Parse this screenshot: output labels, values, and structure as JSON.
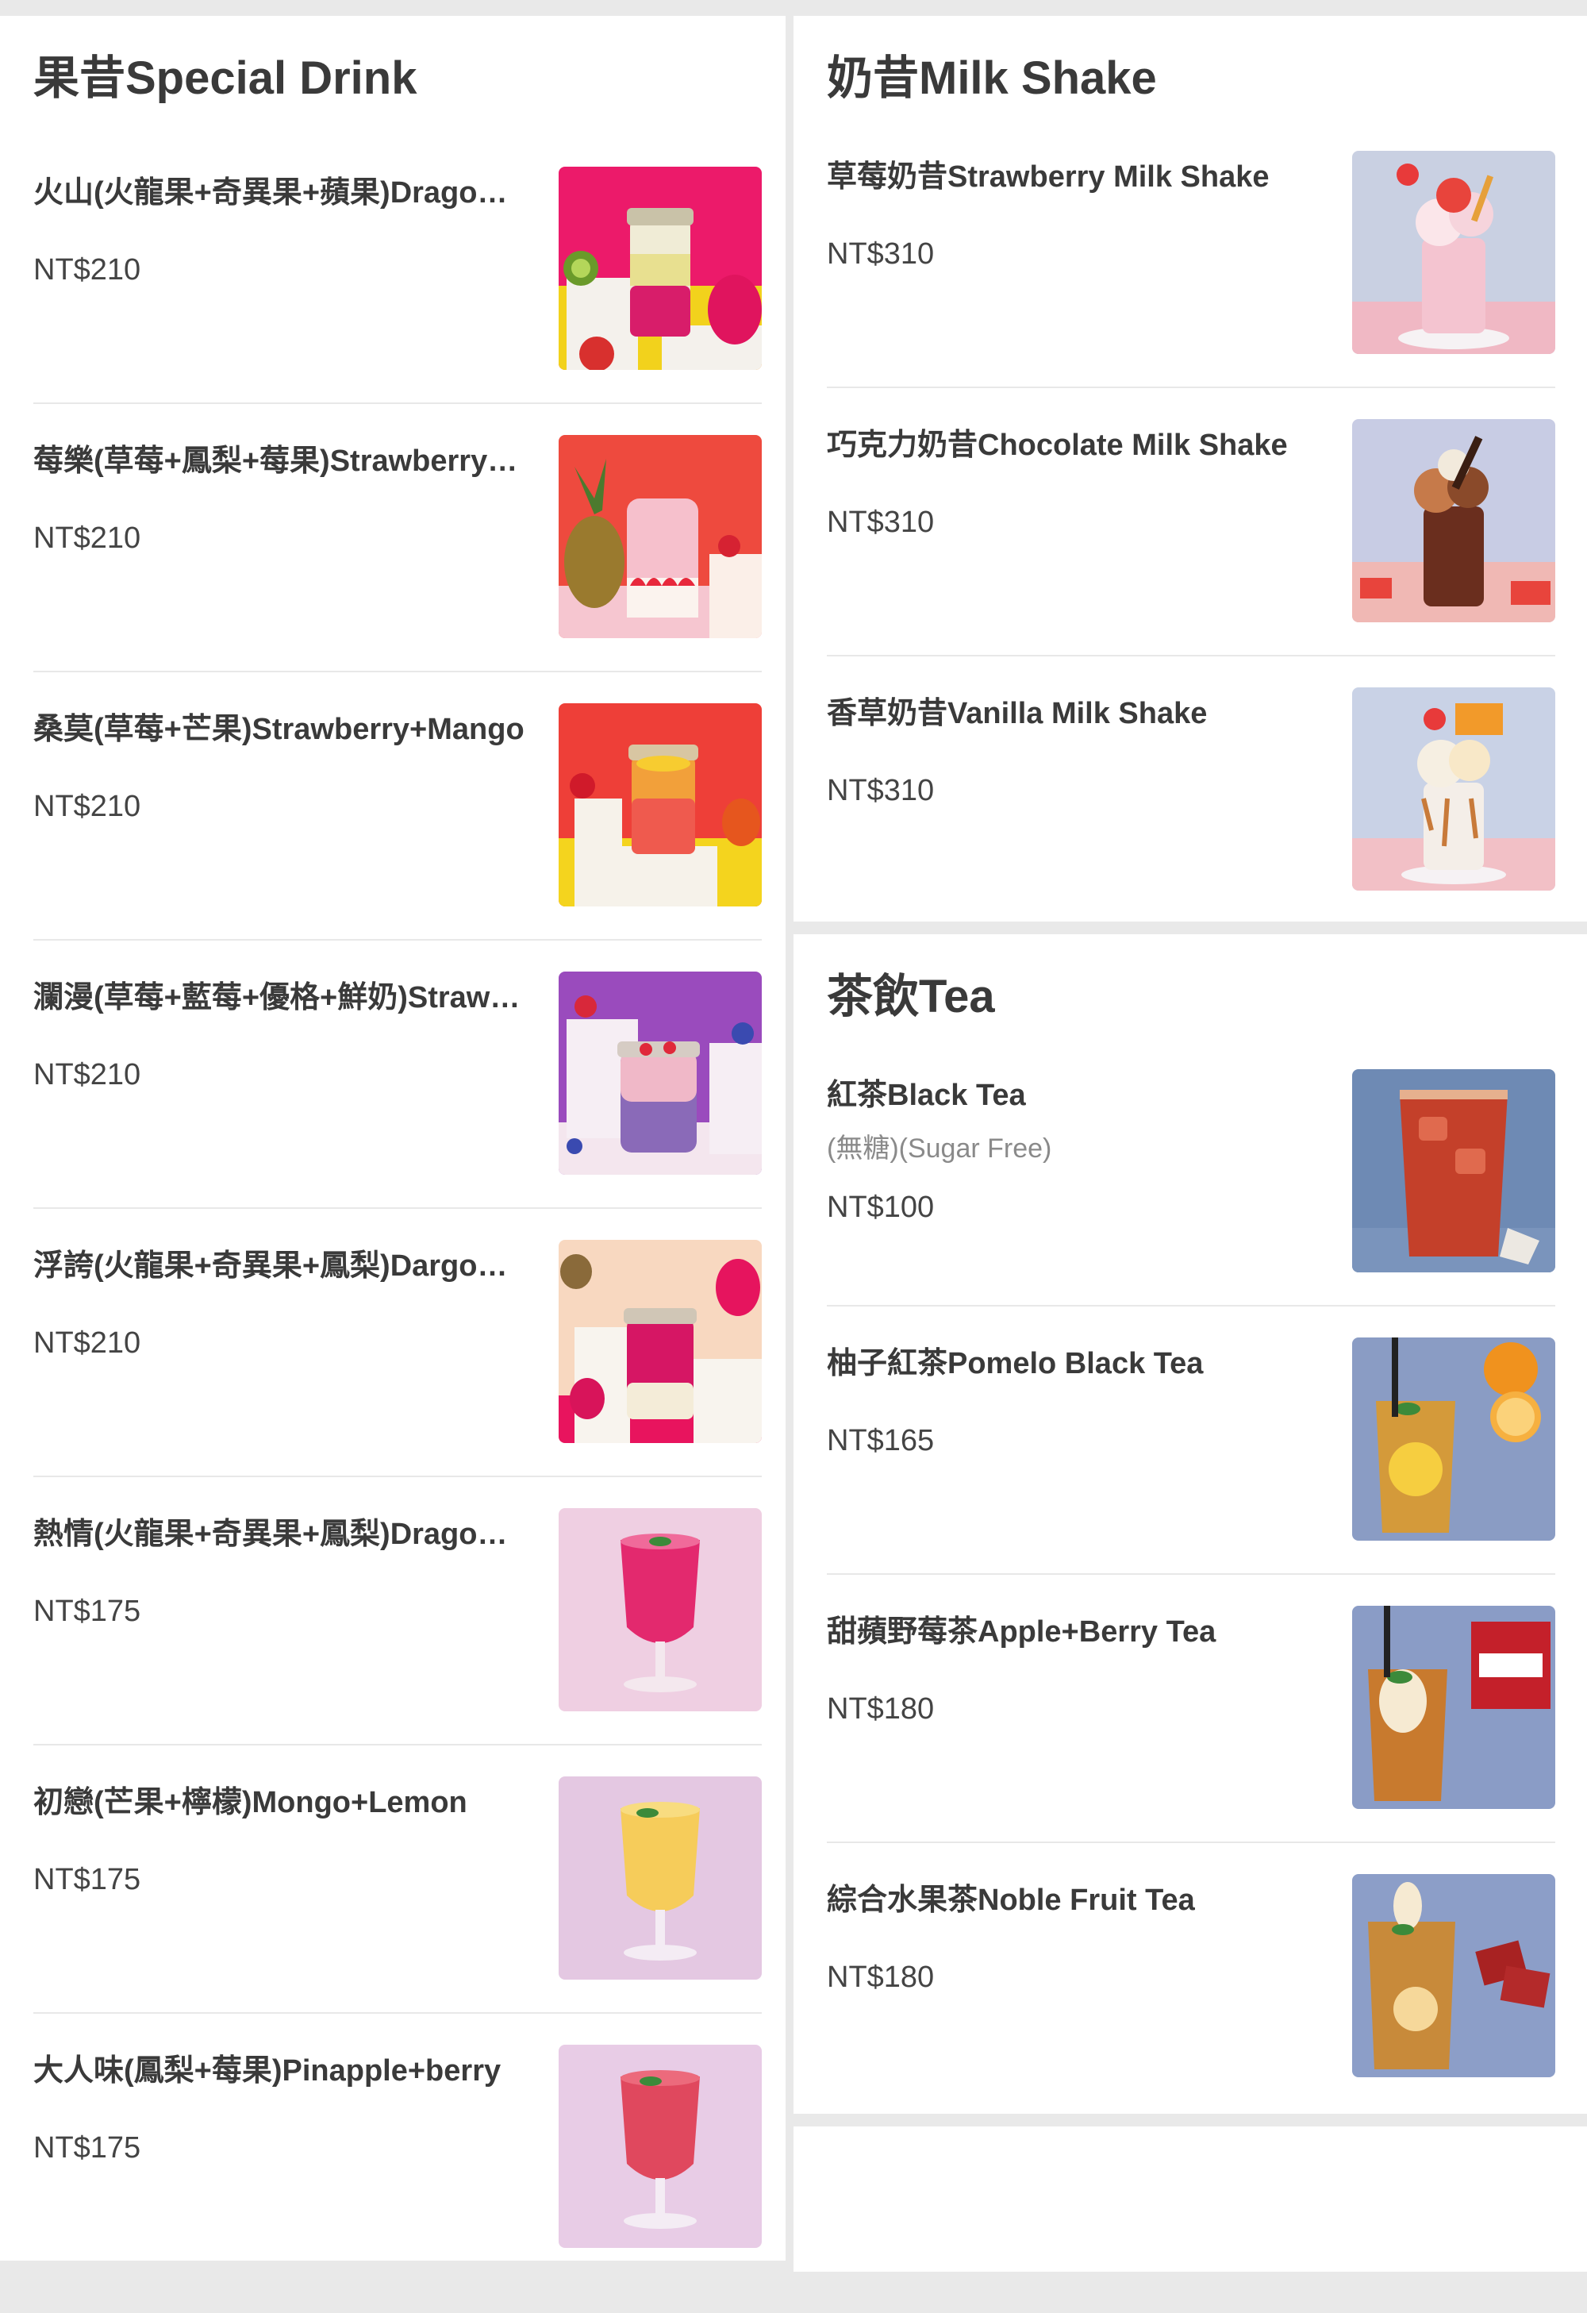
{
  "sections": {
    "special": {
      "title": "果昔Special Drink",
      "items": [
        {
          "name": "火山(火龍果+奇異果+蘋果)Dragon fruit+Kiwi+Apple",
          "price": "NT$210",
          "image": "dragonfruit-kiwi-jar-photo"
        },
        {
          "name": "莓樂(草莓+鳳梨+莓果)Strawberry+Pineapple+Berry",
          "price": "NT$210",
          "image": "strawberry-pineapple-jar-photo"
        },
        {
          "name": "桑莫(草莓+芒果)Strawberry+Mango",
          "price": "NT$210",
          "image": "strawberry-mango-jar-photo"
        },
        {
          "name": "瀾漫(草莓+藍莓+優格+鮮奶)Strawberry+Blueberry+Yogurt+Milk",
          "price": "NT$210",
          "image": "berry-yogurt-jar-photo"
        },
        {
          "name": "浮誇(火龍果+奇異果+鳳梨)Dargon fruit+Kiwi+Pineapple",
          "price": "NT$210",
          "image": "dragonfruit-pineapple-jar-photo"
        },
        {
          "name": "熱情(火龍果+奇異果+鳳梨)Dragon fruit+Kiwi+Pineapple",
          "price": "NT$175",
          "image": "magenta-smoothie-glass-photo"
        },
        {
          "name": "初戀(芒果+檸檬)Mongo+Lemon",
          "price": "NT$175",
          "image": "mango-lemon-glass-photo"
        },
        {
          "name": "大人味(鳳梨+莓果)Pinapple+berry",
          "price": "NT$175",
          "image": "berry-smoothie-glass-photo"
        }
      ]
    },
    "milkshake": {
      "title": "奶昔Milk Shake",
      "items": [
        {
          "name": "草莓奶昔Strawberry Milk Shake",
          "price": "NT$310",
          "image": "strawberry-shake-photo"
        },
        {
          "name": "巧克力奶昔Chocolate Milk Shake",
          "price": "NT$310",
          "image": "chocolate-shake-photo"
        },
        {
          "name": "香草奶昔Vanilla Milk Shake",
          "price": "NT$310",
          "image": "vanilla-shake-photo"
        }
      ]
    },
    "tea": {
      "title": "茶飲Tea",
      "items": [
        {
          "name": "紅茶Black Tea",
          "desc": "(無糖)(Sugar Free)",
          "price": "NT$100",
          "image": "black-tea-photo"
        },
        {
          "name": "柚子紅茶Pomelo Black Tea",
          "price": "NT$165",
          "image": "pomelo-tea-photo"
        },
        {
          "name": "甜蘋野莓茶Apple+Berry Tea",
          "price": "NT$180",
          "image": "apple-berry-tea-photo"
        },
        {
          "name": "綜合水果茶Noble Fruit Tea",
          "price": "NT$180",
          "image": "fruit-tea-photo"
        }
      ]
    }
  }
}
